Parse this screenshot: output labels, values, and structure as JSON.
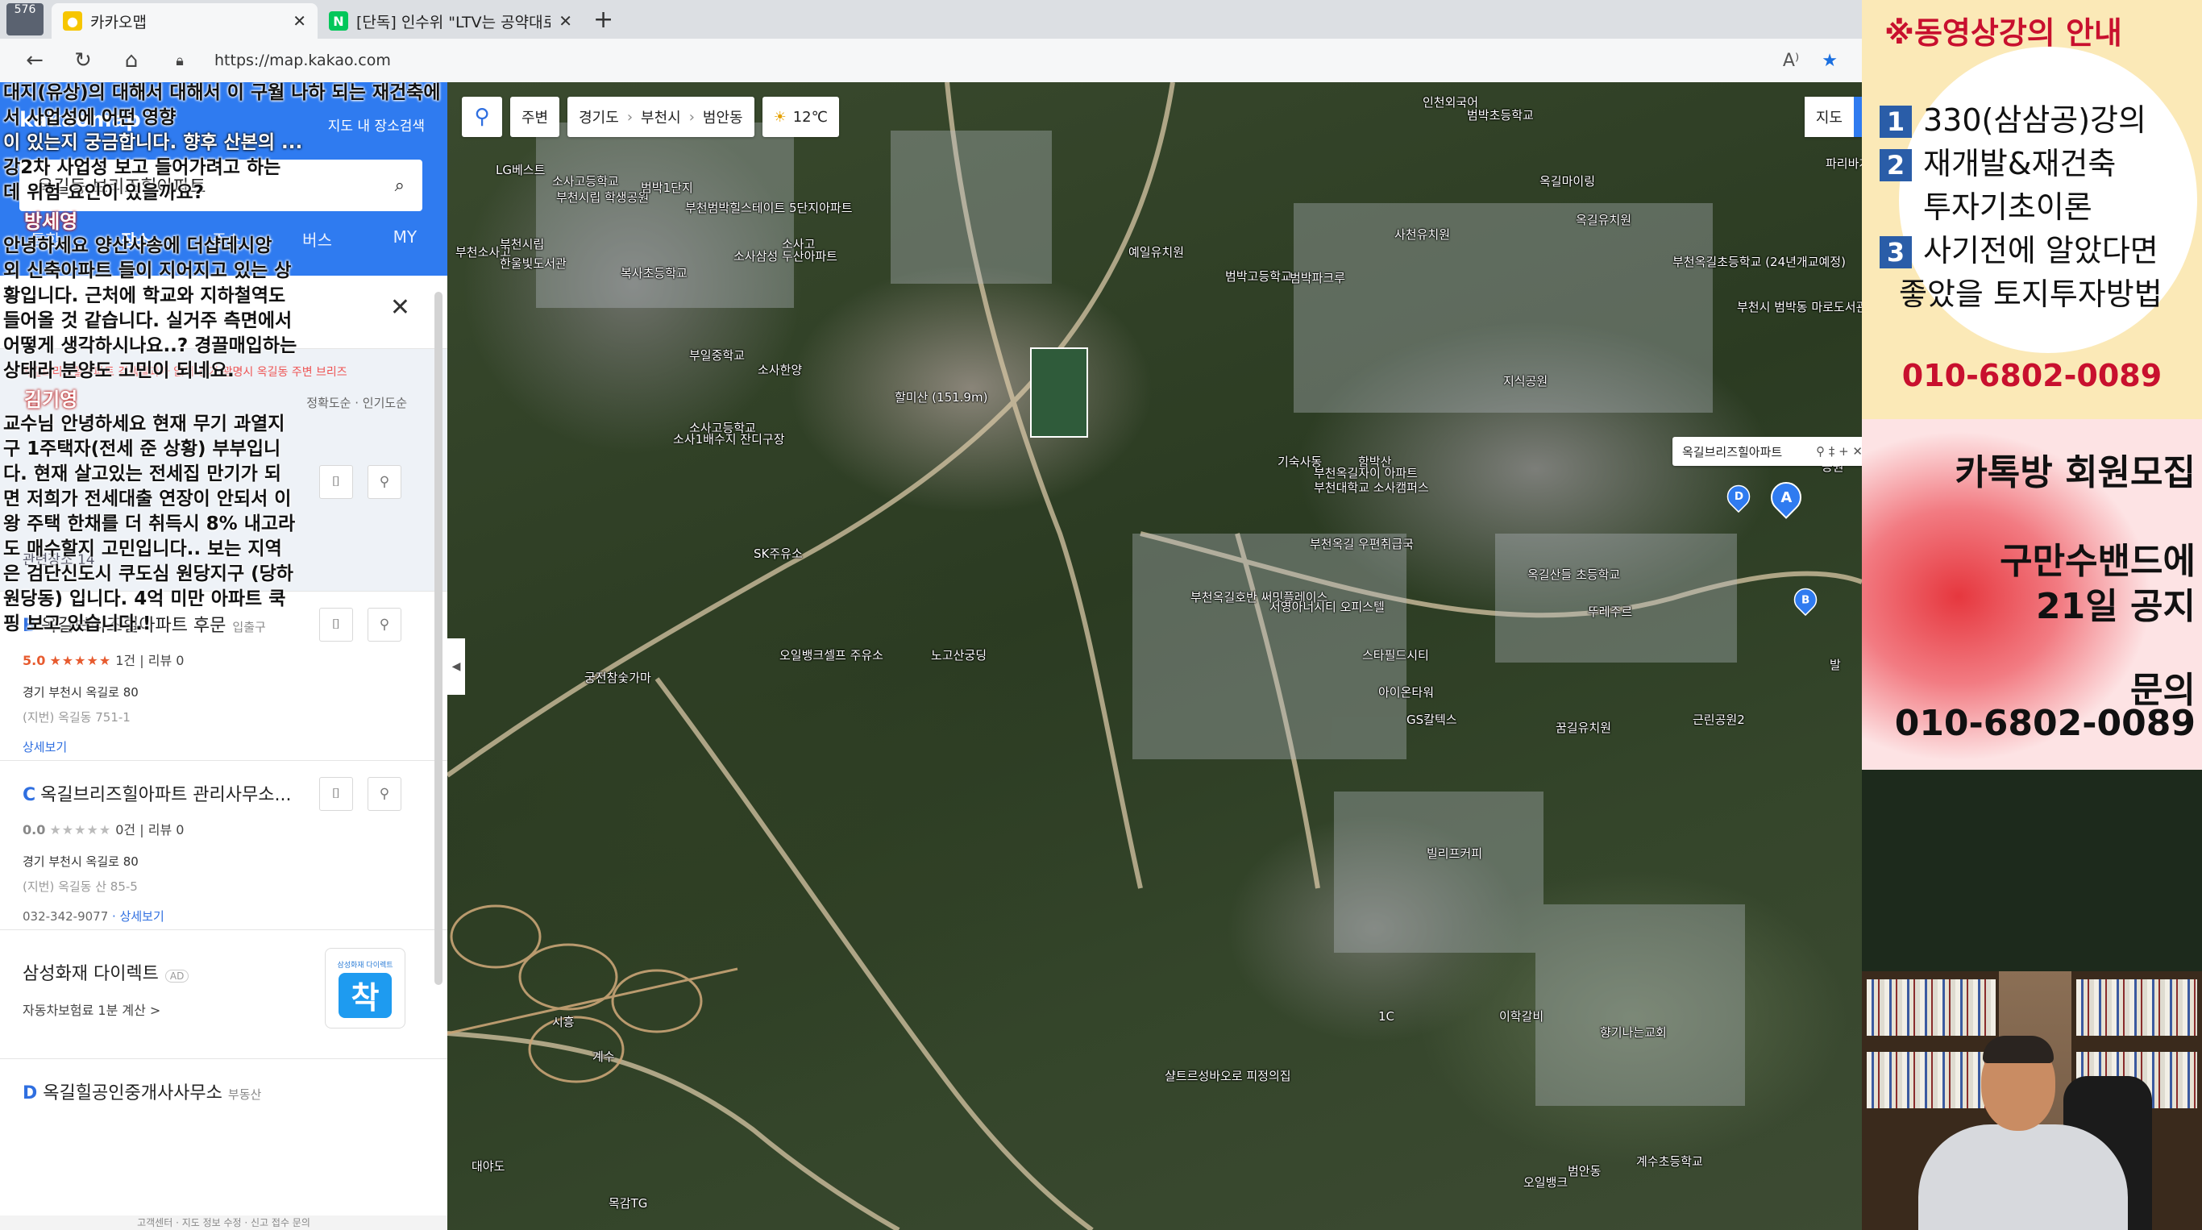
{
  "browser": {
    "tab_counter": "576",
    "tabs": [
      {
        "title": "카카오맵",
        "favicon_color": "#f7c600"
      },
      {
        "title": "[단독] 인수위 \"LTV는 공약대로 \"",
        "favicon_color": "#03c75a"
      }
    ],
    "favicon_letters": {
      "naver": "N"
    },
    "url": "https://map.kakao.com",
    "new_tab": "+",
    "close": "✕"
  },
  "left_panel": {
    "logo": "kakaomap",
    "top_right": "지도 내 장소검색",
    "search_value": "옥길동 브리즈힐아파트",
    "tabs": [
      "통합",
      "장소",
      "주소",
      "버스",
      "MY"
    ],
    "filter_notice": "옥길브리즈힐아파트 검색결과가 없어 경기 광명시 옥길동 주변 브리즈",
    "sort": [
      "정확도순",
      "인기도순"
    ],
    "related": "관련장소 14",
    "results": [
      {
        "marker": "B",
        "name": "옥길브리즈힐아파트 후문",
        "category": "입출구",
        "score": "5.0",
        "stars": "★★★★★",
        "review_count": "1건",
        "blog_count": "리뷰 0",
        "address": "경기 부천시 옥길로 80",
        "jibun": "(지번) 옥길동 751-1",
        "more": "상세보기",
        "phone": ""
      },
      {
        "marker": "C",
        "name": "옥길브리즈힐아파트 관리사무소...",
        "category": "",
        "score": "0.0",
        "stars": "★★★★★",
        "review_count": "0건",
        "blog_count": "리뷰 0",
        "address": "경기 부천시 옥길로 80",
        "jibun": "(지번) 옥길동 산 85-5",
        "more": "상세보기",
        "phone": "032-342-9077"
      }
    ],
    "ad": {
      "name": "삼성화재 다이렉트",
      "tag": "AD",
      "sub": "자동차보험료 1분 계산 >",
      "logo_small": "삼성화재 다이렉트",
      "logo_big": "착"
    },
    "last_item": {
      "marker": "D",
      "name": "옥길힐공인중개사사무소",
      "category": "부동산"
    },
    "footer": "고객센터 · 지도 정보 수정 · 신고 접수 문의"
  },
  "chat": [
    {
      "type": "text",
      "light": false,
      "text": "대지(유상)의 대해서 대해서 이 구월 나하 되는 재건축에서 사업성에 어떤 영향"
    },
    {
      "type": "text",
      "light": true,
      "text": "이 있는지 궁금합니다. 향후 산본의 ..."
    },
    {
      "type": "text",
      "light": false,
      "text": "강2차 사업성 보고 들어가려고 하는"
    },
    {
      "type": "text",
      "light": false,
      "text": "데 위험 요인이 있을까요?"
    },
    {
      "type": "user",
      "mod": true,
      "text": "방세영"
    },
    {
      "type": "text",
      "light": false,
      "text": "안녕하세요 양산사송에 더샵데시앙"
    },
    {
      "type": "text",
      "light": false,
      "text": "외 신축아파트 들이 지어지고 있는 상"
    },
    {
      "type": "text",
      "light": false,
      "text": "황입니다. 근처에 학교와 지하철역도"
    },
    {
      "type": "text",
      "light": false,
      "text": "들어올 것 같습니다. 실거주 측면에서"
    },
    {
      "type": "text",
      "light": false,
      "text": "어떻게 생각하시나요..? 경끌매입하는"
    },
    {
      "type": "text",
      "light": false,
      "text": "상태라 분양도 고민이 되네요."
    },
    {
      "type": "user",
      "mod": true,
      "text": "김기영"
    },
    {
      "type": "text",
      "light": false,
      "text": "교수님 안녕하세요 현재 무기 과열지"
    },
    {
      "type": "text",
      "light": false,
      "text": "구 1주택자(전세 준 상황) 부부입니"
    },
    {
      "type": "text",
      "light": false,
      "text": "다. 현재 살고있는 전세집 만기가 되"
    },
    {
      "type": "text",
      "light": false,
      "text": "면 저희가 전세대출 연장이 안되서 이"
    },
    {
      "type": "text",
      "light": false,
      "text": "왕 주택 한채를 더 취득시 8% 내고라"
    },
    {
      "type": "text",
      "light": false,
      "text": "도 매수할지 고민입니다.. 보는 지역"
    },
    {
      "type": "text",
      "light": false,
      "text": "은 검단신도시 쿠도심 원당지구 (당하"
    },
    {
      "type": "text",
      "light": false,
      "text": "원당동) 입니다. 4억 미만 아파트 쿡"
    },
    {
      "type": "text",
      "light": false,
      "text": "핑 보고 있습니다.!"
    }
  ],
  "map": {
    "pin_icon": "map-pin-icon",
    "nearby": "주변",
    "breadcrumb": [
      "경기도",
      "부천시",
      "범안동"
    ],
    "weather": "12℃",
    "map_type": "지도",
    "tooltip": "옥길브리즈힐아파트",
    "tooltip_icons": "⚲ ‡ + ✕",
    "markers": [
      "A",
      "B",
      "D"
    ],
    "labels": [
      "인천외국어",
      "범박초등학교",
      "LG베스트",
      "소사고등학교",
      "부천시립 학생공원",
      "범박1단지",
      "부천범박힐스테이트 5단지아파트",
      "부천소사고",
      "부천시립",
      "한울빛도서관",
      "복사초등학교",
      "소사삼성 두산아파트",
      "소사고",
      "예일유치원",
      "범박고등학교",
      "범박파크루",
      "사천유치원",
      "옥길유치원",
      "부천옥길초등학교 (24년개교예정)",
      "부천시 범박동 마로도서관 (22년6월예정)",
      "부일중학교",
      "소사한양",
      "할미산 (151.9m)",
      "소사고등학교",
      "지식공원",
      "소사1배수지 잔디구장",
      "기숙사동",
      "부천대학교 소사캠퍼스",
      "함박산",
      "부천옥길자이 아파트",
      "SK주유소",
      "부천옥길 우편취급국",
      "옥길산들 초등학교",
      "뚜레주르",
      "부천옥길호반 써밋플레이스",
      "서영아너시티 오피스텔",
      "스타필드시티",
      "궁전참숯가마",
      "오일뱅크셀프 주유소",
      "노고산궁딩",
      "아이온타워",
      "GS칼텍스",
      "꿈길유치원",
      "근린공원2",
      "빌리프커피",
      "샬트르성바오로 피정의집",
      "이학갈비",
      "향기나는교회",
      "대야도",
      "오일뱅크",
      "계수초등학교",
      "1C",
      "시흥",
      "계수",
      "목감TG",
      "발",
      "공원",
      "파리바게트",
      "옥길마이링",
      "범안동"
    ]
  },
  "promo": {
    "title": "※동영상강의 안내",
    "items": [
      {
        "num": "1",
        "text": "330(삼삼공)강의"
      },
      {
        "num": "2",
        "text": "재개발&재건축"
      },
      {
        "num": "",
        "text": "투자기초이론"
      },
      {
        "num": "3",
        "text": "사기전에 알았다면"
      },
      {
        "num": "",
        "text": "좋았을 토지투자방법"
      }
    ],
    "phone1": "010-6802-0089",
    "kakao_title": "카톡방 회원모집",
    "band_line1": "구만수밴드에",
    "band_line2": "21일 공지",
    "inquiry": "문의",
    "phone2": "010-6802-0089"
  },
  "colors": {
    "kakao_blue": "#2f7bf0",
    "promo_red": "#c8102e",
    "promo_yellow": "#fbe9b7",
    "rating_orange": "#e75b2f"
  }
}
